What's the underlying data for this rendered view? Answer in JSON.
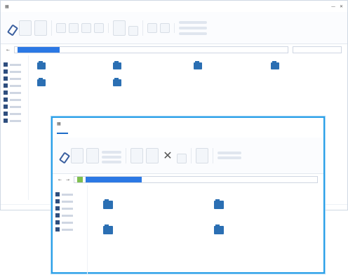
{
  "back": {
    "title": "",
    "folders": [
      {
        "label": ""
      },
      {
        "label": ""
      },
      {
        "label": ""
      },
      {
        "label": ""
      },
      {
        "label": ""
      },
      {
        "label": ""
      }
    ]
  },
  "front": {
    "tabs": [
      "",
      "",
      "",
      ""
    ],
    "folders": [
      {
        "label": ""
      },
      {
        "label": ""
      },
      {
        "label": ""
      },
      {
        "label": ""
      }
    ]
  },
  "colors": {
    "accent": "#2aa0e8",
    "selection": "#2b78e4",
    "folder": "#2b6fb3"
  }
}
